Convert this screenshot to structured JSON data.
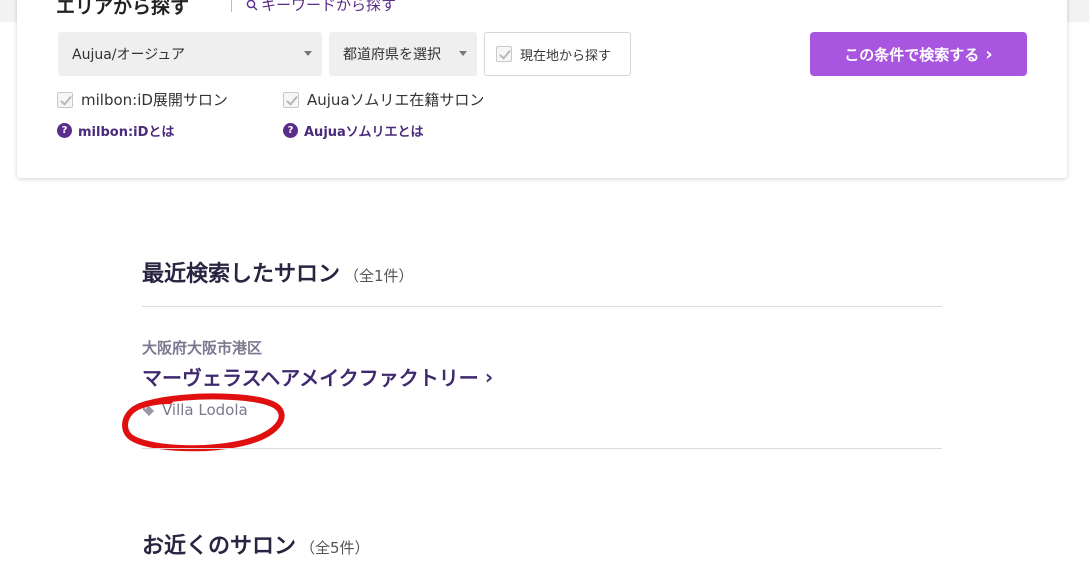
{
  "header": {
    "area_title": "エリアから探す",
    "keyword_tab": "キーワードから探す"
  },
  "filters": {
    "brand_select": "Aujua/オージュア",
    "prefecture_select": "都道府県を選択",
    "current_location": "現在地から探す",
    "search_button": "この条件で検索する",
    "milbon_checkbox": "milbon:iD展開サロン",
    "aujua_checkbox": "Aujuaソムリエ在籍サロン",
    "milbon_help": "milbon:iDとは",
    "aujua_help": "Aujuaソムリエとは",
    "help_mark": "?",
    "chevron": "›"
  },
  "recent": {
    "title": "最近検索したサロン",
    "count": "（全1件）",
    "salon": {
      "area": "大阪府大阪市港区",
      "name": "マーヴェラスヘアメイクファクトリー",
      "tag": "Villa Lodola"
    }
  },
  "nearby": {
    "title": "お近くのサロン",
    "count": "（全5件）"
  },
  "colors": {
    "accent": "#a855e0",
    "brand_dark": "#3f2a6e",
    "annotation": "#e01010"
  },
  "icons": [
    "search-icon",
    "caret-down-icon",
    "checkbox-icon",
    "chevron-right-icon",
    "help-icon",
    "tag-icon"
  ]
}
